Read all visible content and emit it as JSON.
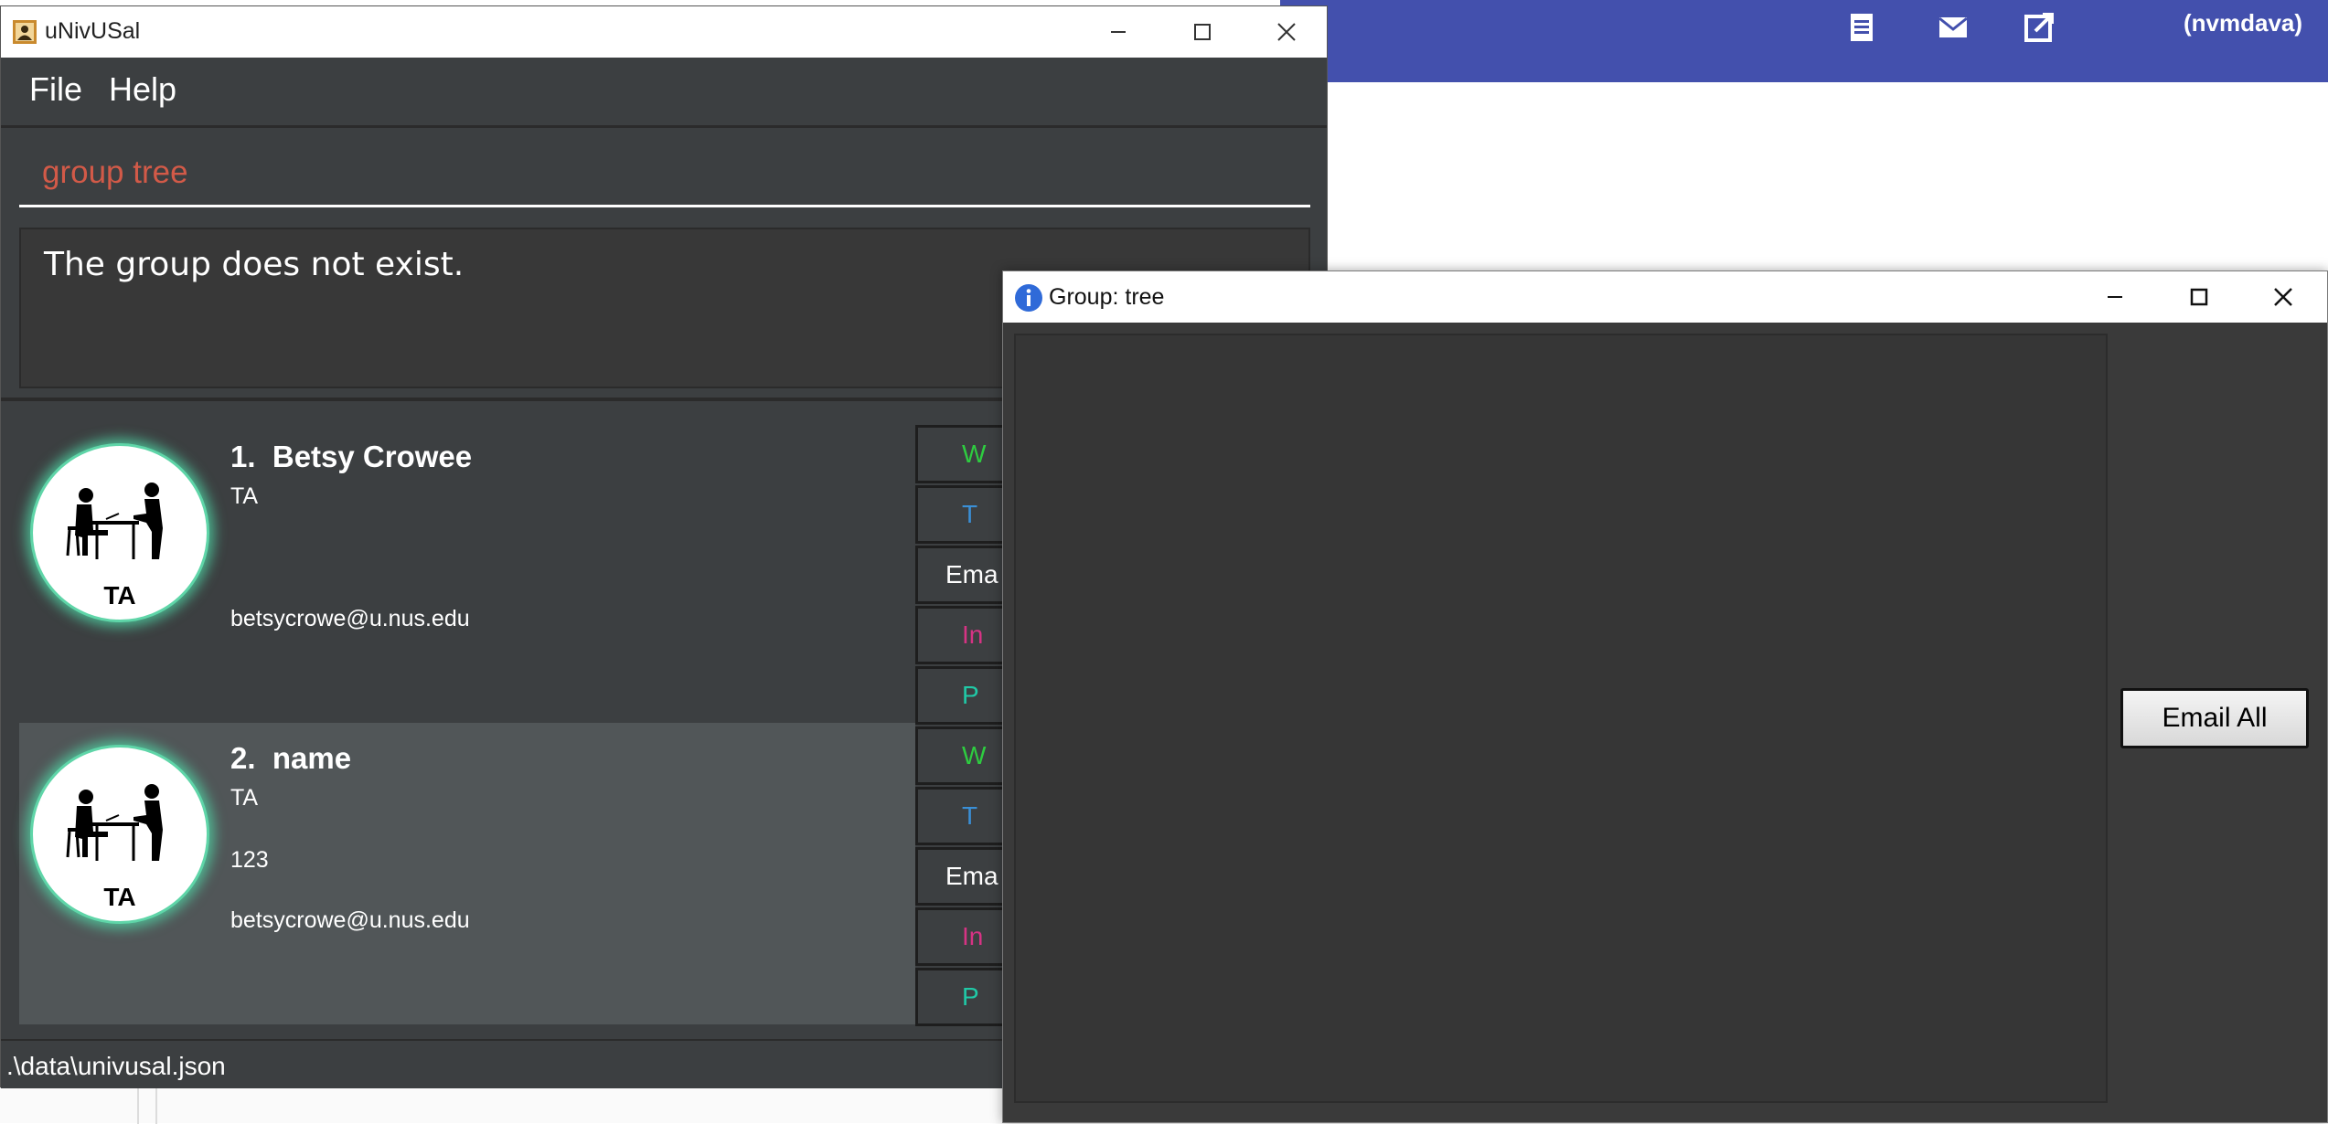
{
  "background": {
    "user_label": "(nvmdava)",
    "icons": [
      "receipt-icon",
      "mail-icon",
      "open-external-icon",
      "expand-icon"
    ]
  },
  "main_window": {
    "title": "uNivUSal",
    "menu": [
      "File",
      "Help"
    ],
    "command_input": "group tree",
    "result": "The group does not exist.",
    "status": ".\\data\\univusal.json",
    "contacts": [
      {
        "index": "1.",
        "name": "Betsy Crowee",
        "role": "TA",
        "phone": "",
        "email": "betsycrowe@u.nus.edu",
        "avatar_label": "TA"
      },
      {
        "index": "2.",
        "name": "name",
        "role": "TA",
        "phone": "123",
        "email": "betsycrowe@u.nus.edu",
        "avatar_label": "TA"
      }
    ],
    "side_buttons": [
      {
        "label": "W",
        "color": "#2ecc40"
      },
      {
        "label": "T",
        "color": "#3a8fd6"
      },
      {
        "label": "Ema",
        "color": "#ffffff"
      },
      {
        "label": "In",
        "color": "#d63384"
      },
      {
        "label": "P",
        "color": "#20c9a6"
      }
    ]
  },
  "group_window": {
    "title": "Group: tree",
    "email_all_label": "Email All"
  }
}
